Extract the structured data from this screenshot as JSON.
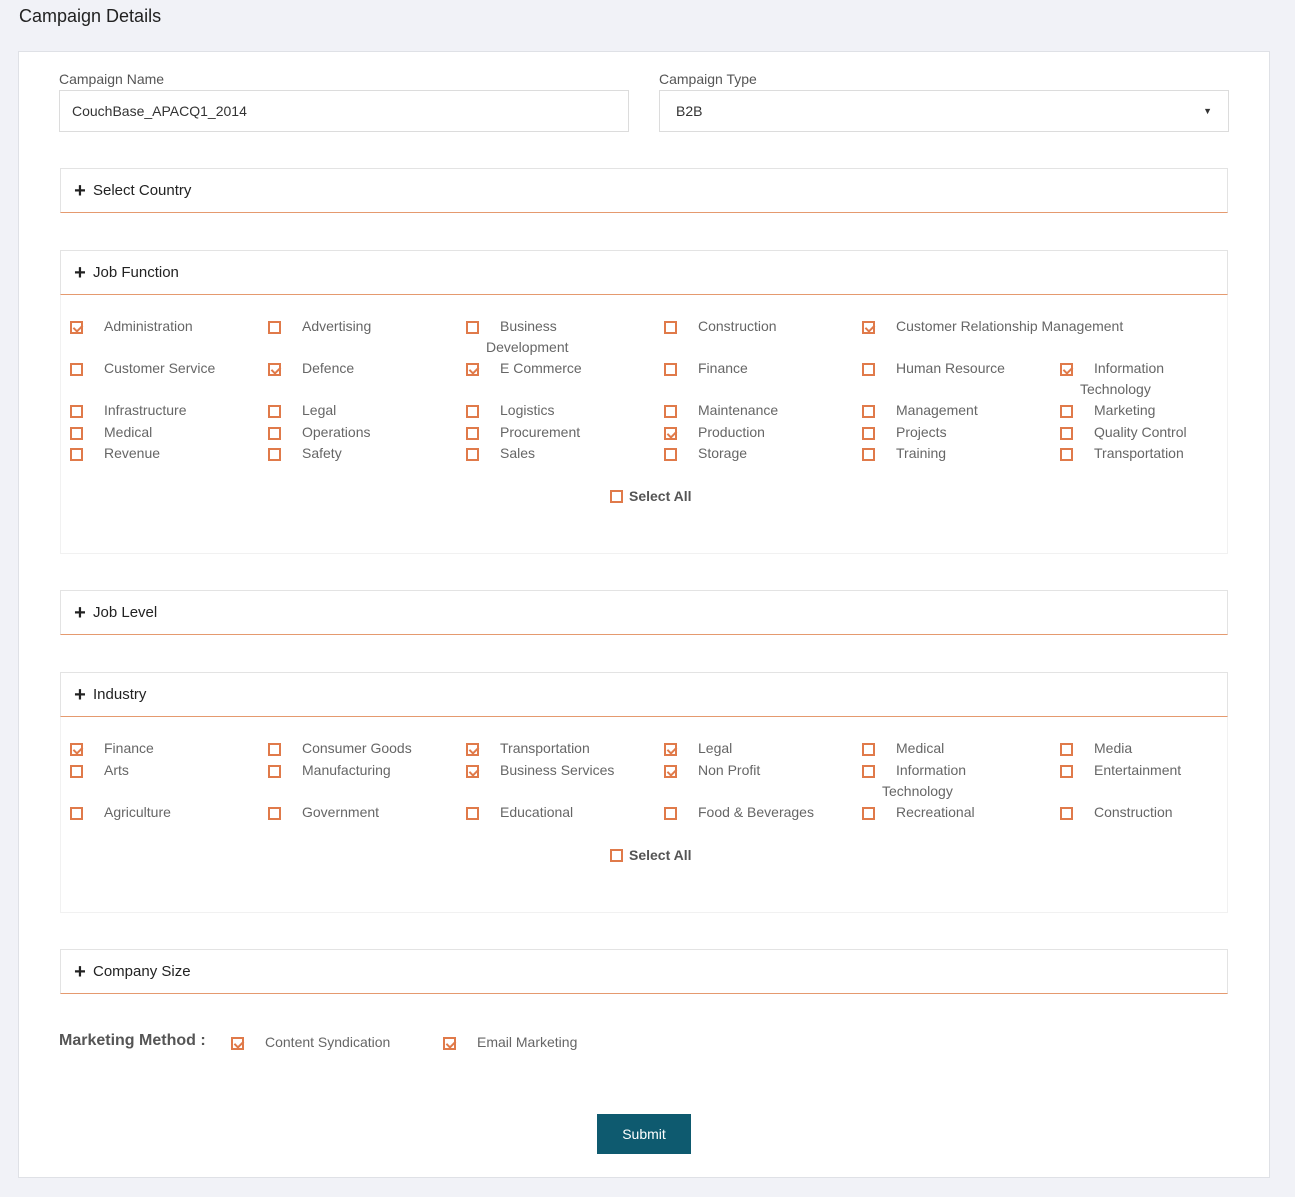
{
  "page": {
    "title": "Campaign Details"
  },
  "form": {
    "campaign_name_label": "Campaign Name",
    "campaign_name_value": "CouchBase_APACQ1_2014",
    "campaign_type_label": "Campaign Type",
    "campaign_type_value": "B2B"
  },
  "panels": {
    "select_country": "Select Country",
    "job_function": "Job Function",
    "job_level": "Job Level",
    "industry": "Industry",
    "company_size": "Company Size"
  },
  "job_function": {
    "options": [
      {
        "label": "Administration",
        "checked": true
      },
      {
        "label": "Advertising",
        "checked": false
      },
      {
        "label": "Business Development",
        "checked": false
      },
      {
        "label": "Construction",
        "checked": false
      },
      {
        "label": "Customer Relationship Management",
        "checked": true
      },
      {
        "label": "Customer Service",
        "checked": false
      },
      {
        "label": "Defence",
        "checked": true
      },
      {
        "label": "E Commerce",
        "checked": true
      },
      {
        "label": "Finance",
        "checked": false
      },
      {
        "label": "Human Resource",
        "checked": false
      },
      {
        "label": "Information Technology",
        "checked": true
      },
      {
        "label": "Infrastructure",
        "checked": false
      },
      {
        "label": "Legal",
        "checked": false
      },
      {
        "label": "Logistics",
        "checked": false
      },
      {
        "label": "Maintenance",
        "checked": false
      },
      {
        "label": "Management",
        "checked": false
      },
      {
        "label": "Marketing",
        "checked": false
      },
      {
        "label": "Medical",
        "checked": false
      },
      {
        "label": "Operations",
        "checked": false
      },
      {
        "label": "Procurement",
        "checked": false
      },
      {
        "label": "Production",
        "checked": true
      },
      {
        "label": "Projects",
        "checked": false
      },
      {
        "label": "Quality Control",
        "checked": false
      },
      {
        "label": "Revenue",
        "checked": false
      },
      {
        "label": "Safety",
        "checked": false
      },
      {
        "label": "Sales",
        "checked": false
      },
      {
        "label": "Storage",
        "checked": false
      },
      {
        "label": "Training",
        "checked": false
      },
      {
        "label": "Transportation",
        "checked": false
      }
    ],
    "select_all": {
      "label": "Select All",
      "checked": false
    }
  },
  "industry": {
    "options": [
      {
        "label": "Finance",
        "checked": true
      },
      {
        "label": "Consumer Goods",
        "checked": false
      },
      {
        "label": "Transportation",
        "checked": true
      },
      {
        "label": "Legal",
        "checked": true
      },
      {
        "label": "Medical",
        "checked": false
      },
      {
        "label": "Media",
        "checked": false
      },
      {
        "label": "Arts",
        "checked": false
      },
      {
        "label": "Manufacturing",
        "checked": false
      },
      {
        "label": "Business Services",
        "checked": true
      },
      {
        "label": "Non Profit",
        "checked": true
      },
      {
        "label": "Information Technology",
        "checked": false
      },
      {
        "label": "Entertainment",
        "checked": false
      },
      {
        "label": "Agriculture",
        "checked": false
      },
      {
        "label": "Government",
        "checked": false
      },
      {
        "label": "Educational",
        "checked": false
      },
      {
        "label": "Food & Beverages",
        "checked": false
      },
      {
        "label": "Recreational",
        "checked": false
      },
      {
        "label": "Construction",
        "checked": false
      }
    ],
    "select_all": {
      "label": "Select All",
      "checked": false
    }
  },
  "marketing_method": {
    "label": "Marketing Method :",
    "options": [
      {
        "label": "Content Syndication",
        "checked": true
      },
      {
        "label": "Email Marketing",
        "checked": true
      }
    ]
  },
  "submit_label": "Submit",
  "colors": {
    "accent": "#e07a4a",
    "submit": "#0e5a6f",
    "background": "#f1f2f7"
  }
}
